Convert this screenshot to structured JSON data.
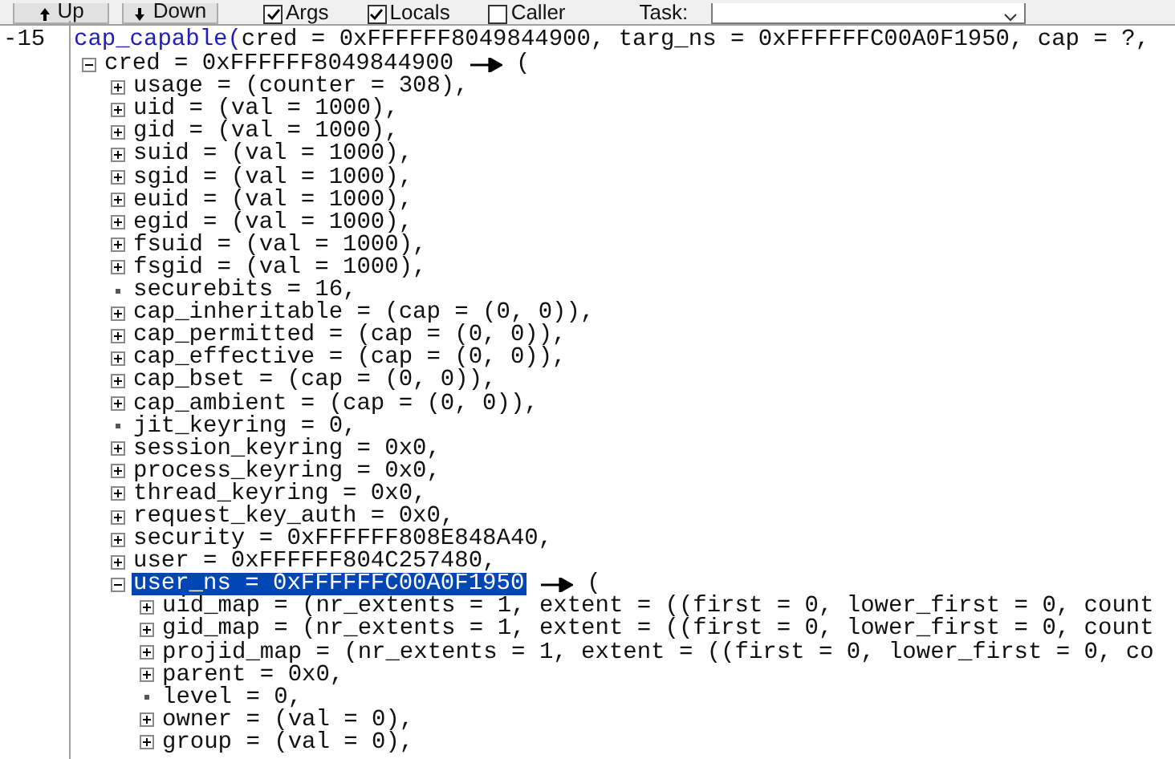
{
  "toolbar": {
    "buttons": [
      {
        "label": "Up",
        "kind": "up"
      },
      {
        "label": "Down",
        "kind": "down"
      }
    ],
    "checkboxes": [
      {
        "label": "Args",
        "checked": true
      },
      {
        "label": "Locals",
        "checked": true
      },
      {
        "label": "Caller",
        "checked": false
      }
    ],
    "task": {
      "label": "Task:"
    }
  },
  "frame": {
    "number": "-15",
    "function": "cap_capable(",
    "args": "cred = 0xFFFFFF8049844900, targ_ns = 0xFFFFFFC00A0F1950, cap = ?,"
  },
  "tree": [
    {
      "label": "cred = 0xFFFFFF8049844900",
      "kind": "struct",
      "expanded": true,
      "selected": false,
      "open_paren": "(",
      "children": [
        {
          "label": "usage = (counter = 308),",
          "kind": "struct",
          "expanded": false,
          "selected": false
        },
        {
          "label": "uid = (val = 1000),",
          "kind": "struct",
          "expanded": false,
          "selected": false
        },
        {
          "label": "gid = (val = 1000),",
          "kind": "struct",
          "expanded": false,
          "selected": false
        },
        {
          "label": "suid = (val = 1000),",
          "kind": "struct",
          "expanded": false,
          "selected": false
        },
        {
          "label": "sgid = (val = 1000),",
          "kind": "struct",
          "expanded": false,
          "selected": false
        },
        {
          "label": "euid = (val = 1000),",
          "kind": "struct",
          "expanded": false,
          "selected": false
        },
        {
          "label": "egid = (val = 1000),",
          "kind": "struct",
          "expanded": false,
          "selected": false
        },
        {
          "label": "fsuid = (val = 1000),",
          "kind": "struct",
          "expanded": false,
          "selected": false
        },
        {
          "label": "fsgid = (val = 1000),",
          "kind": "struct",
          "expanded": false,
          "selected": false
        },
        {
          "label": "securebits = 16,",
          "kind": "scalar",
          "selected": false
        },
        {
          "label": "cap_inheritable = (cap = (0, 0)),",
          "kind": "struct",
          "expanded": false,
          "selected": false
        },
        {
          "label": "cap_permitted = (cap = (0, 0)),",
          "kind": "struct",
          "expanded": false,
          "selected": false
        },
        {
          "label": "cap_effective = (cap = (0, 0)),",
          "kind": "struct",
          "expanded": false,
          "selected": false
        },
        {
          "label": "cap_bset = (cap = (0, 0)),",
          "kind": "struct",
          "expanded": false,
          "selected": false
        },
        {
          "label": "cap_ambient = (cap = (0, 0)),",
          "kind": "struct",
          "expanded": false,
          "selected": false
        },
        {
          "label": "jit_keyring = 0,",
          "kind": "scalar",
          "selected": false
        },
        {
          "label": "session_keyring = 0x0,",
          "kind": "struct",
          "expanded": false,
          "selected": false
        },
        {
          "label": "process_keyring = 0x0,",
          "kind": "struct",
          "expanded": false,
          "selected": false
        },
        {
          "label": "thread_keyring = 0x0,",
          "kind": "struct",
          "expanded": false,
          "selected": false
        },
        {
          "label": "request_key_auth = 0x0,",
          "kind": "struct",
          "expanded": false,
          "selected": false
        },
        {
          "label": "security = 0xFFFFFF808E848A40,",
          "kind": "struct",
          "expanded": false,
          "selected": false
        },
        {
          "label": "user = 0xFFFFFF804C257480,",
          "kind": "struct",
          "expanded": false,
          "selected": false
        },
        {
          "label": "user_ns = 0xFFFFFFC00A0F1950",
          "kind": "struct",
          "expanded": true,
          "selected": true,
          "open_paren": "(",
          "children": [
            {
              "label": "uid_map = (nr_extents = 1, extent = ((first = 0, lower_first = 0, count",
              "kind": "struct",
              "expanded": false,
              "selected": false
            },
            {
              "label": "gid_map = (nr_extents = 1, extent = ((first = 0, lower_first = 0, count",
              "kind": "struct",
              "expanded": false,
              "selected": false
            },
            {
              "label": "projid_map = (nr_extents = 1, extent = ((first = 0, lower_first = 0, co",
              "kind": "struct",
              "expanded": false,
              "selected": false
            },
            {
              "label": "parent = 0x0,",
              "kind": "struct",
              "expanded": false,
              "selected": false
            },
            {
              "label": "level = 0,",
              "kind": "scalar",
              "selected": false
            },
            {
              "label": "owner = (val = 0),",
              "kind": "struct",
              "expanded": false,
              "selected": false
            },
            {
              "label": "group = (val = 0),",
              "kind": "struct",
              "expanded": false,
              "selected": false
            }
          ]
        }
      ]
    }
  ]
}
